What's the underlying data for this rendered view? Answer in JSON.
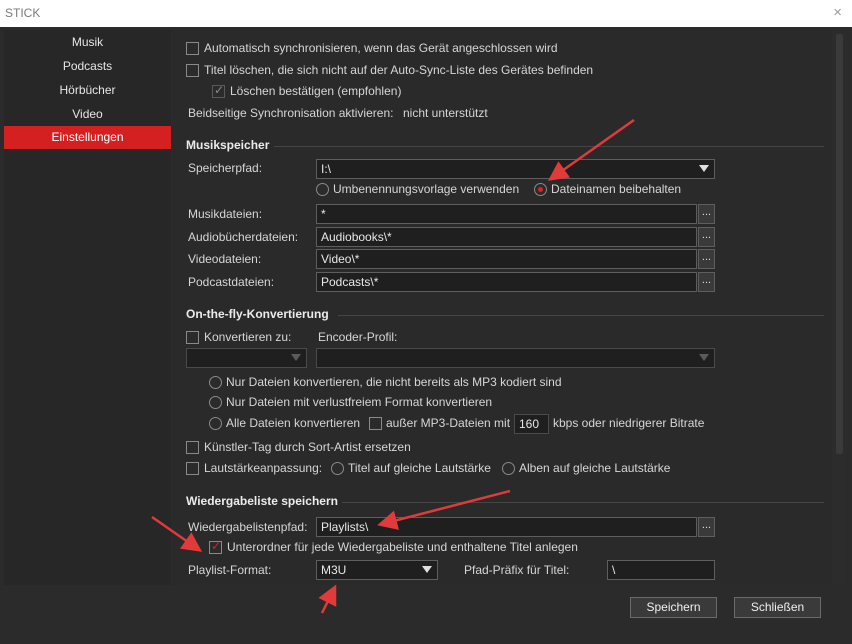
{
  "window": {
    "title": "STICK",
    "close_glyph": "×"
  },
  "sidebar": {
    "items": [
      "Musik",
      "Podcasts",
      "Hörbücher",
      "Video",
      "Einstellungen"
    ],
    "active": "Einstellungen"
  },
  "sync": {
    "auto_sync": "Automatisch synchronisieren, wenn das Gerät angeschlossen wird",
    "delete_titles": "Titel löschen, die sich nicht auf der Auto-Sync-Liste des Gerätes befinden",
    "confirm_delete": "Löschen bestätigen (empfohlen)",
    "bidirectional_label": "Beidseitige Synchronisation aktivieren:",
    "bidirectional_value": "nicht unterstützt"
  },
  "music_storage": {
    "title": "Musikspeicher",
    "path_label": "Speicherpfad:",
    "path_value": "I:\\",
    "opt_rename": "Umbenennungsvorlage verwenden",
    "opt_keep": "Dateinamen beibehalten",
    "music_label": "Musikdateien:",
    "music_value": "*",
    "audiobook_label": "Audiobücherdateien:",
    "audiobook_value": "Audiobooks\\*",
    "video_label": "Videodateien:",
    "video_value": "Video\\*",
    "podcast_label": "Podcastdateien:",
    "podcast_value": "Podcasts\\*",
    "browse_label": "..."
  },
  "conversion": {
    "title": "On-the-fly-Konvertierung",
    "convert_to": "Konvertieren zu:",
    "encoder_profile": "Encoder-Profil:",
    "opt_non_mp3": "Nur Dateien konvertieren, die nicht bereits als MP3 kodiert sind",
    "opt_lossless": "Nur Dateien mit verlustfreiem Format konvertieren",
    "opt_all": "Alle Dateien konvertieren",
    "except_mp3": "außer MP3-Dateien mit",
    "bitrate_value": "160",
    "bitrate_suffix": "kbps oder niedrigerer Bitrate",
    "artist_tag": "Künstler-Tag durch Sort-Artist ersetzen",
    "volume_label": "Lautstärkeanpassung:",
    "opt_track_volume": "Titel auf gleiche Lautstärke",
    "opt_album_volume": "Alben auf gleiche Lautstärke"
  },
  "playlist": {
    "title": "Wiedergabeliste speichern",
    "path_label": "Wiedergabelistenpfad:",
    "path_value": "Playlists\\",
    "subfolder": "Unterordner für jede Wiedergabeliste und enthaltene Titel anlegen",
    "format_label": "Playlist-Format:",
    "format_value": "M3U",
    "prefix_label": "Pfad-Präfix für Titel:",
    "prefix_value": "\\"
  },
  "footer": {
    "save": "Speichern",
    "close": "Schließen"
  },
  "colors": {
    "accent": "#d42020",
    "annotation_arrow": "#e03a3a",
    "background": "#2b2b2b"
  }
}
